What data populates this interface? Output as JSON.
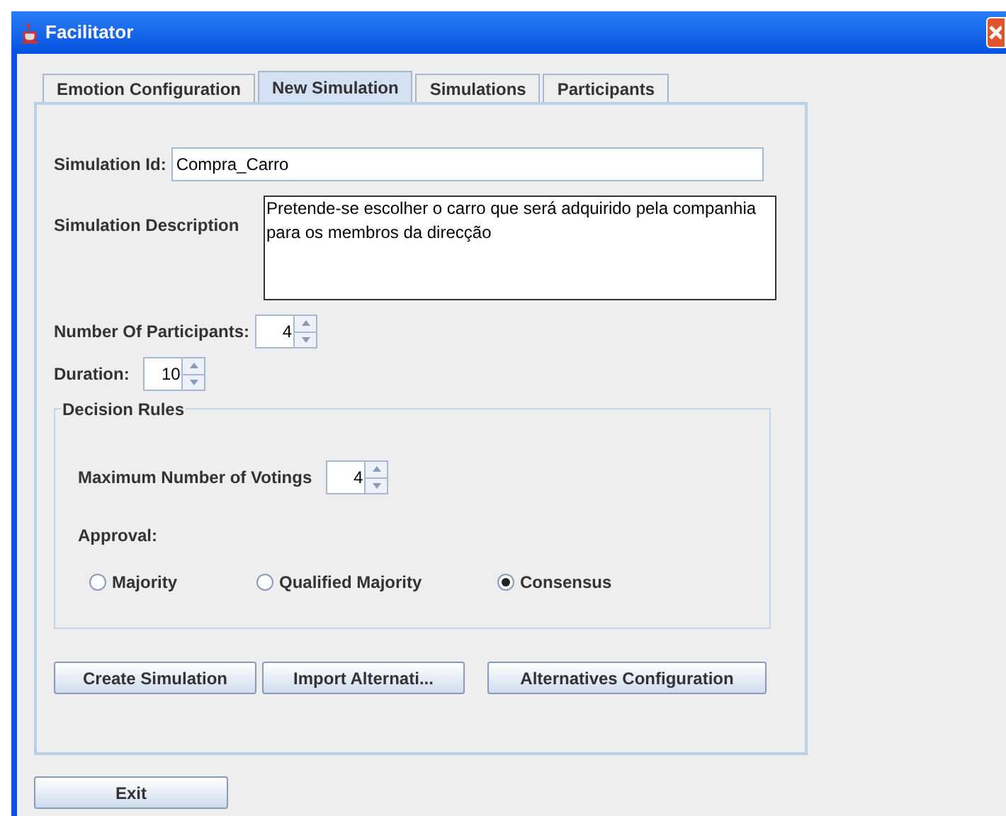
{
  "window": {
    "title": "Facilitator"
  },
  "tabs": [
    {
      "label": "Emotion Configuration",
      "selected": false
    },
    {
      "label": "New Simulation",
      "selected": true
    },
    {
      "label": "Simulations",
      "selected": false
    },
    {
      "label": "Participants",
      "selected": false
    }
  ],
  "simulation_id": {
    "label": "Simulation Id:",
    "value": "Compra_Carro"
  },
  "simulation_description": {
    "label": "Simulation Description",
    "value": "Pretende-se escolher o carro que será adquirido pela companhia para os membros da direcção"
  },
  "number_of_participants": {
    "label": "Number Of Participants:",
    "value": "4"
  },
  "duration": {
    "label": "Duration:",
    "value": "10"
  },
  "decision_rules": {
    "title": "Decision Rules",
    "max_votings": {
      "label": "Maximum Number of Votings",
      "value": "4"
    },
    "approval_label": "Approval:",
    "approval_options": [
      {
        "label": "Majority",
        "selected": false
      },
      {
        "label": "Qualified Majority",
        "selected": false
      },
      {
        "label": "Consensus",
        "selected": true
      }
    ]
  },
  "buttons": [
    "Create Simulation",
    "Import Alternati...",
    "Alternatives Configuration"
  ],
  "exit_button": "Exit"
}
